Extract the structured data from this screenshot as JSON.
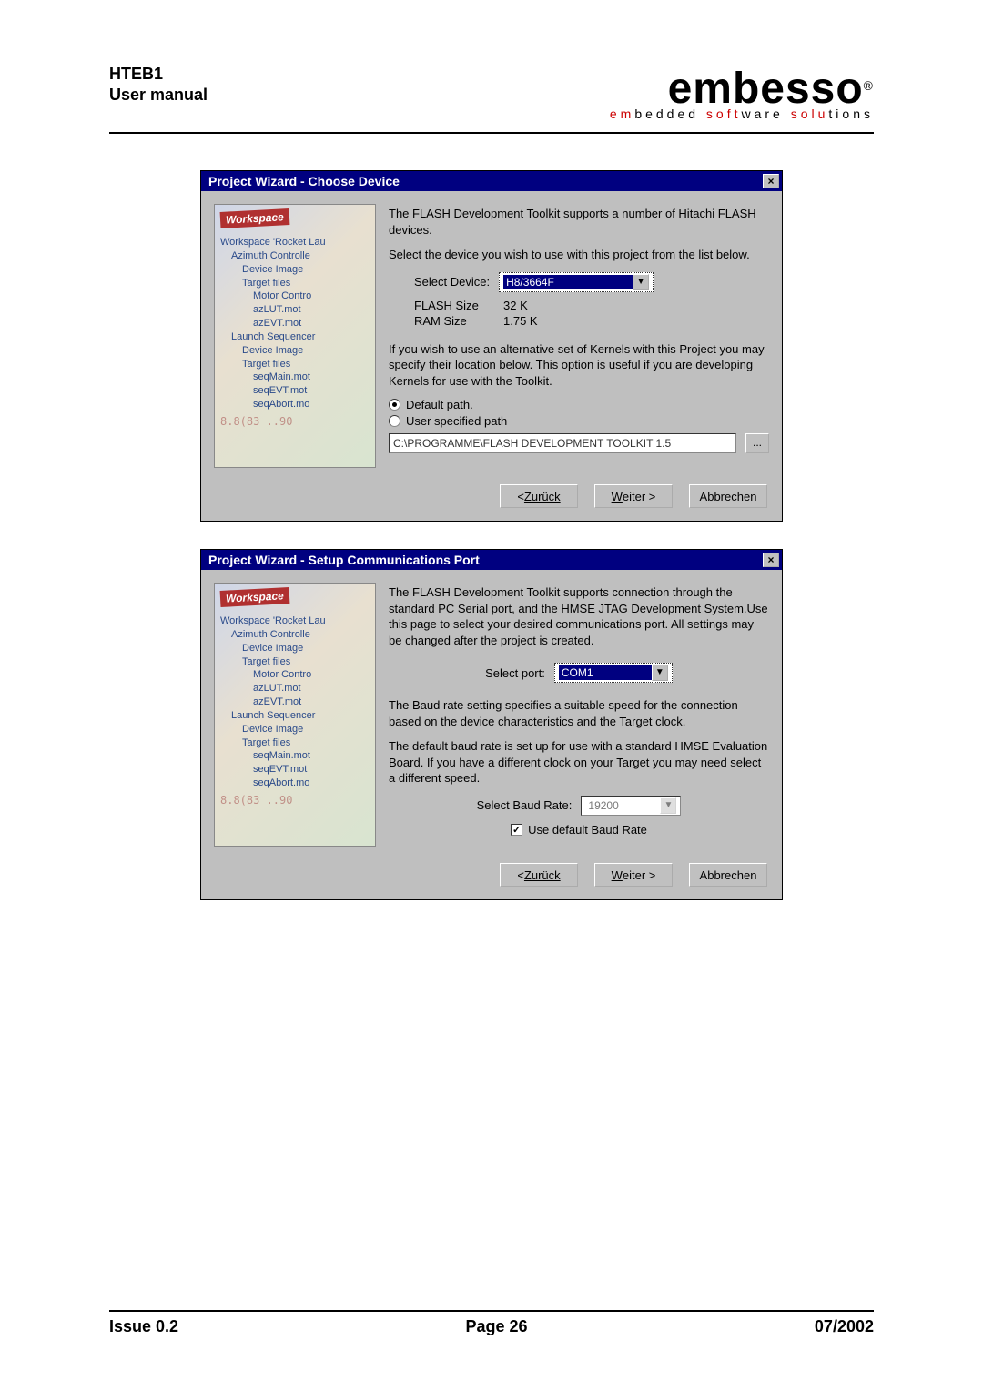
{
  "header": {
    "line1": "HTEB1",
    "line2": "User manual"
  },
  "logo": {
    "main": "embesso",
    "sub_parts": [
      "em",
      "bedded ",
      "soft",
      "ware ",
      "solu",
      "tions"
    ]
  },
  "dialog1": {
    "title": "Project Wizard - Choose Device",
    "intro1": "The FLASH Development Toolkit supports a number of Hitachi FLASH devices.",
    "intro2": "Select the device you wish to use with this project from the list below.",
    "select_label": "Select Device:",
    "select_value": "H8/3664F",
    "flash_label": "FLASH Size",
    "flash_value": "32 K",
    "ram_label": "RAM Size",
    "ram_value": "1.75 K",
    "alt_text": "If you wish to use an alternative set of Kernels with this Project you may specify their location below. This option is useful if you are developing Kernels for use with the Toolkit.",
    "radio_default": "Default path.",
    "radio_user": "User specified path",
    "path_value": "C:\\PROGRAMME\\FLASH DEVELOPMENT TOOLKIT 1.5",
    "browse": "..."
  },
  "dialog2": {
    "title": "Project Wizard - Setup Communications Port",
    "intro": "The FLASH Development Toolkit supports connection through the standard PC Serial port, and the HMSE JTAG Development System.Use this page to select your desired communications port. All settings may be changed after the project is created.",
    "port_label": "Select port:",
    "port_value": "COM1",
    "baud_intro": "The Baud rate setting specifies a suitable speed for the connection based on the device characteristics and the Target clock.",
    "baud_intro2": "The default baud rate is set up for use with a standard HMSE Evaluation Board. If you have a different clock on your Target you may need select a different speed.",
    "baud_label": "Select Baud Rate:",
    "baud_value": "19200",
    "use_default": "Use default Baud Rate"
  },
  "buttons": {
    "back": "Zurück",
    "next": "Weiter >",
    "cancel": "Abbrechen"
  },
  "tree": {
    "ws": "Workspace",
    "ws2": "Workspace 'Rocket Lau",
    "az": "Azimuth Controlle",
    "di": "Device Image",
    "tf": "Target files",
    "mc": "Motor Contro",
    "az1": "azLUT.mot",
    "az2": "azEVT.mot",
    "ls": "Launch Sequencer",
    "di2": "Device Image",
    "tf2": "Target files",
    "sm": "seqMain.mot",
    "sv": "seqEVT.mot",
    "sa": "seqAbort.mo"
  },
  "footer": {
    "issue": "Issue 0.2",
    "page": "Page 26",
    "date": "07/2002"
  }
}
